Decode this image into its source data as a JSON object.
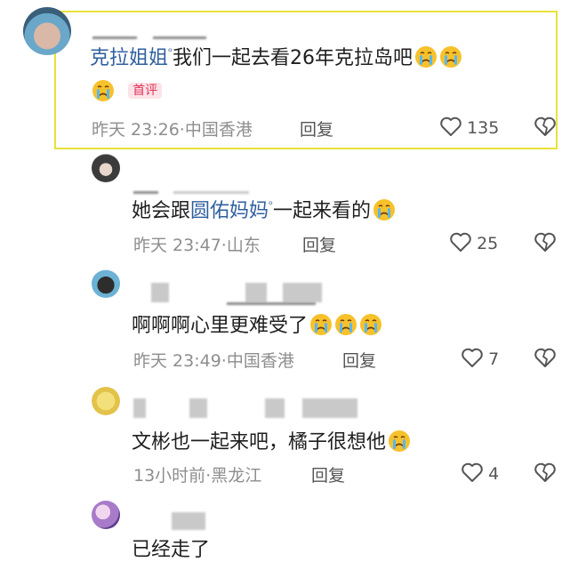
{
  "comments": [
    {
      "name": "克拉姐姐",
      "text": "我们一起去看26年克拉岛吧",
      "badge": "首评",
      "time": "昨天 23:26",
      "location": "中国香港",
      "reply": "回复",
      "likes": "135"
    },
    {
      "text_prefix": "她会跟",
      "mention": "圆佑妈妈",
      "text_suffix": "一起来看的",
      "time": "昨天 23:47",
      "location": "山东",
      "reply": "回复",
      "likes": "25"
    },
    {
      "text": "啊啊啊心里更难受了",
      "time": "昨天 23:49",
      "location": "中国香港",
      "reply": "回复",
      "likes": "7"
    },
    {
      "text": "文彬也一起来吧，橘子很想他",
      "time": "13小时前",
      "location": "黑龙江",
      "reply": "回复",
      "likes": "4"
    },
    {
      "text": "已经走了"
    }
  ],
  "icons": {
    "like": "heart-outline-icon",
    "dislike": "broken-heart-icon",
    "emoji": "crying-face-emoji",
    "verified": "superscript-q-icon"
  },
  "colors": {
    "name": "#2f5f9e",
    "badge": "#e0345a",
    "highlight": "#e8e23a"
  }
}
